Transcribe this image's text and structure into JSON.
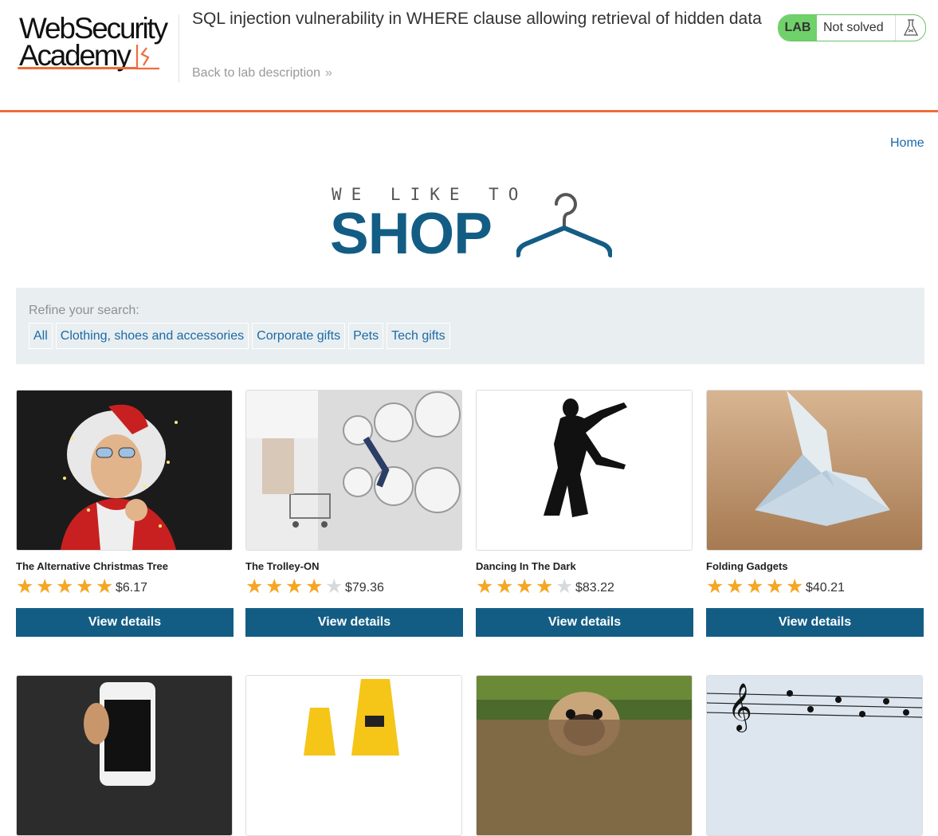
{
  "header": {
    "logo_line1": "WebSecurity",
    "logo_line2": "Academy",
    "lab_title": "SQL injection vulnerability in WHERE clause allowing retrieval of hidden data",
    "back_link": "Back to lab description",
    "status_badge": "LAB",
    "status_text": "Not solved",
    "accent_color": "#ef6c3a",
    "status_color": "#70d06a"
  },
  "nav": {
    "home": "Home"
  },
  "banner": {
    "small": "WE LIKE TO",
    "big": "SHOP",
    "color": "#135d85"
  },
  "filter": {
    "label": "Refine your search:",
    "categories": [
      "All",
      "Clothing, shoes and accessories",
      "Corporate gifts",
      "Pets",
      "Tech gifts"
    ]
  },
  "products": [
    {
      "name": "The Alternative Christmas Tree",
      "rating": 5,
      "price": "$6.17",
      "button": "View details",
      "image": "santa-with-lights-photo"
    },
    {
      "name": "The Trolley-ON",
      "rating": 4,
      "price": "$79.36",
      "button": "View details",
      "image": "laundromat-photo"
    },
    {
      "name": "Dancing In The Dark",
      "rating": 4,
      "price": "$83.22",
      "button": "View details",
      "image": "dancing-silhouette"
    },
    {
      "name": "Folding Gadgets",
      "rating": 5,
      "price": "$40.21",
      "button": "View details",
      "image": "origami-bird-photo"
    }
  ],
  "more_products": [
    {
      "image": "smartphone-photo"
    },
    {
      "image": "wet-floor-signs-photo"
    },
    {
      "image": "pug-photo"
    },
    {
      "image": "birds-on-wire-photo"
    }
  ]
}
